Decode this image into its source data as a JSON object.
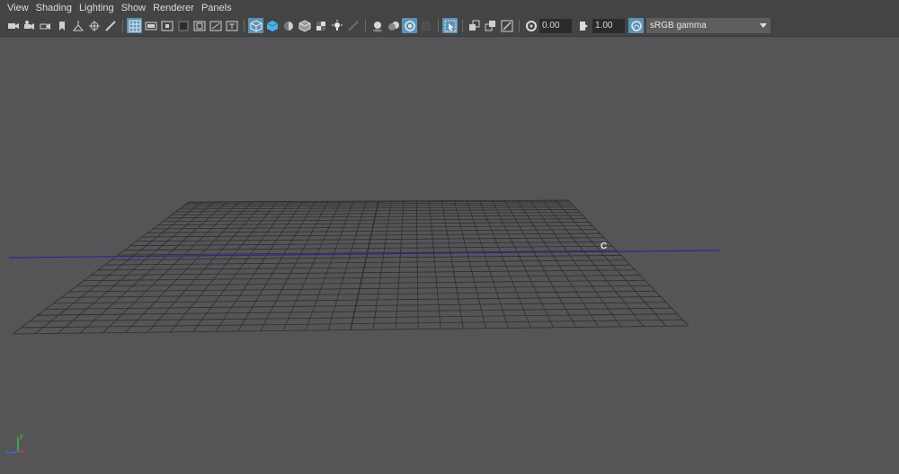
{
  "menu": [
    "View",
    "Shading",
    "Lighting",
    "Show",
    "Renderer",
    "Panels"
  ],
  "toolbar": {
    "exposure_value": "0.00",
    "gamma_value": "1.00",
    "color_space": "sRGB gamma"
  },
  "viewport": {
    "camera_label": "C",
    "background_color": "#555558",
    "grid_color": "#2e2e2e",
    "curve_color": "#2a2a8a"
  },
  "axes": {
    "y": "y",
    "z": "z"
  }
}
